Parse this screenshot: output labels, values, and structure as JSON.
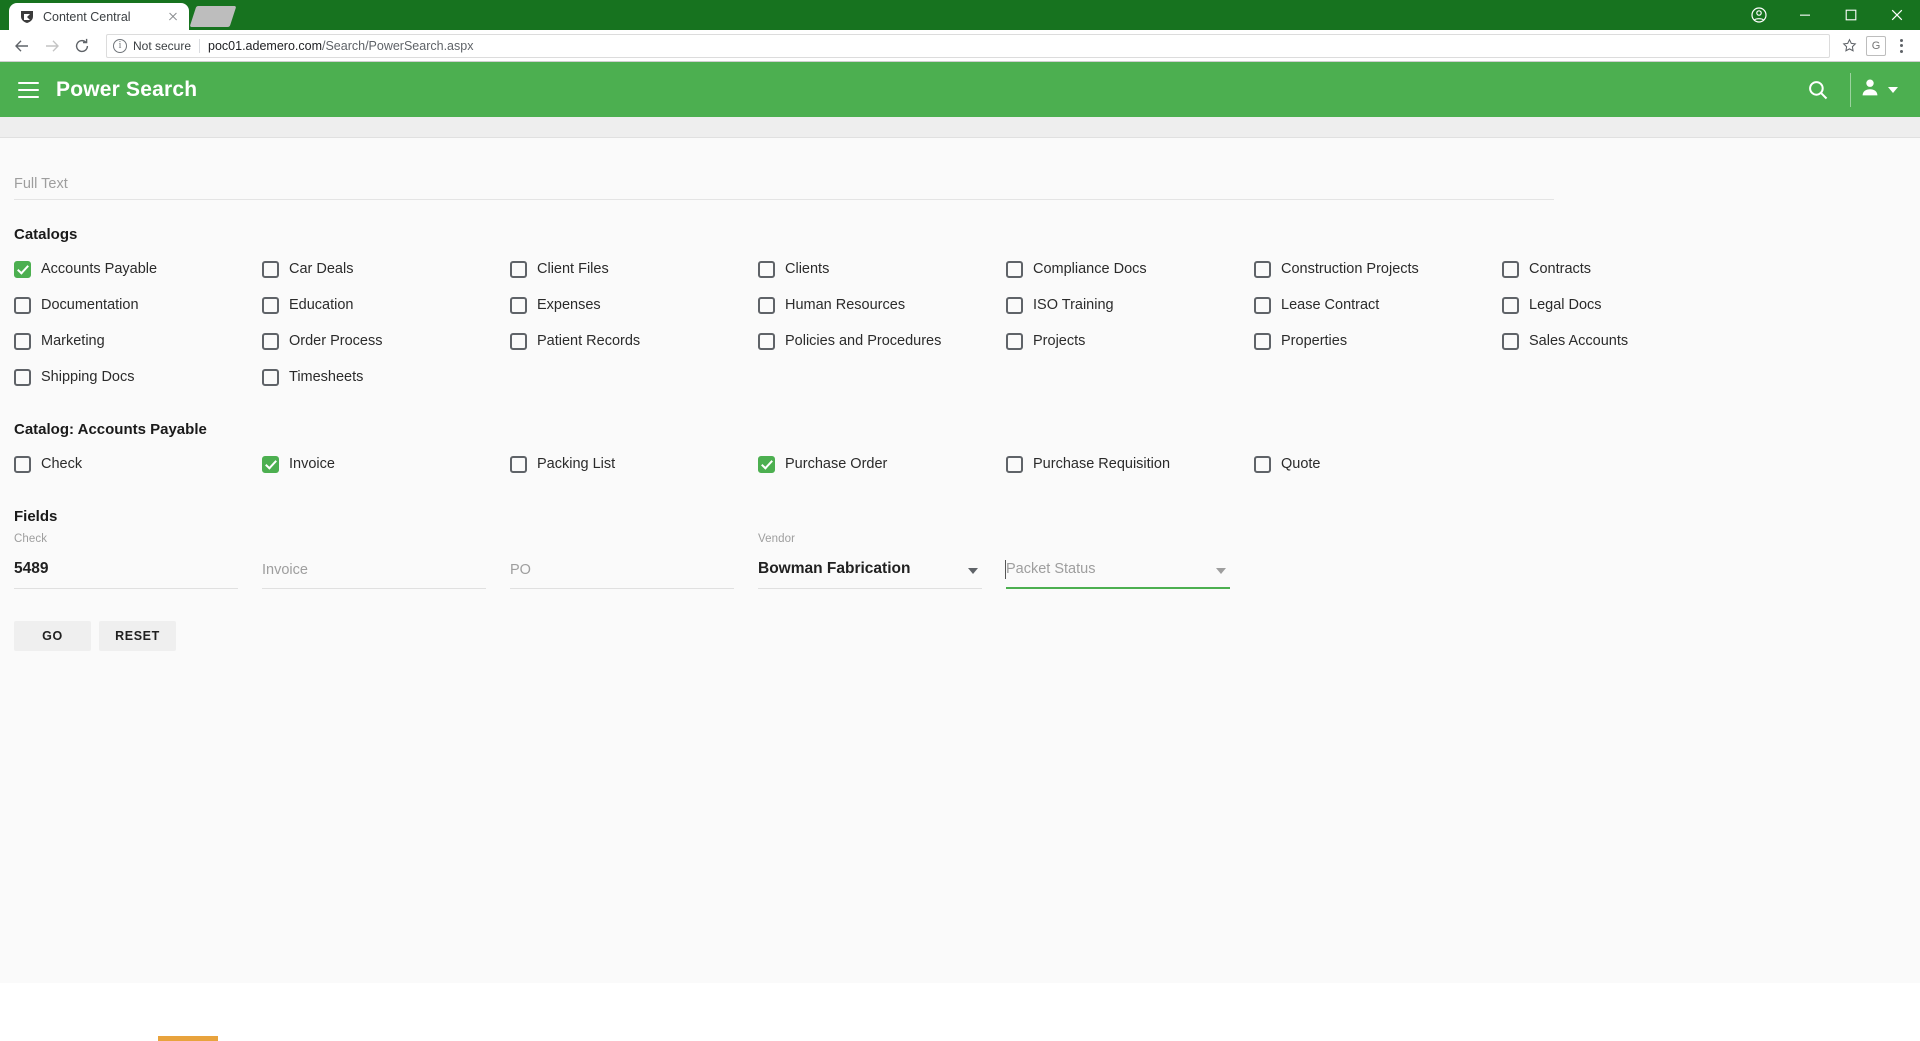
{
  "browser": {
    "tab": {
      "title": "Content Central",
      "favicon_icon": "shield-logo-icon",
      "close_icon": "close-icon"
    },
    "new_tab_icon": "new-tab-icon",
    "window_controls": {
      "account_icon": "account-icon",
      "minimize_icon": "minimize-icon",
      "maximize_icon": "maximize-icon",
      "close_icon": "window-close-icon"
    },
    "nav": {
      "back_icon": "back-arrow-icon",
      "forward_icon": "forward-arrow-icon",
      "reload_icon": "reload-icon"
    },
    "omnibox": {
      "info_icon": "info-circle-icon",
      "security_label": "Not secure",
      "url_host": "poc01.ademero.com",
      "url_path": "/Search/PowerSearch.aspx"
    },
    "toolbar_right": {
      "bookmark_icon": "star-icon",
      "profile_label": "G",
      "menu_icon": "kebab-menu-icon"
    }
  },
  "app": {
    "menu_icon": "hamburger-menu-icon",
    "title": "Power Search",
    "search_icon": "search-icon",
    "user_icon": "user-account-icon",
    "user_caret_icon": "chevron-down-icon",
    "accent_color": "#4caf50"
  },
  "search": {
    "fulltext_placeholder": "Full Text",
    "fulltext_value": ""
  },
  "catalogs": {
    "heading": "Catalogs",
    "items": [
      {
        "label": "Accounts Payable",
        "checked": true
      },
      {
        "label": "Car Deals",
        "checked": false
      },
      {
        "label": "Client Files",
        "checked": false
      },
      {
        "label": "Clients",
        "checked": false
      },
      {
        "label": "Compliance Docs",
        "checked": false
      },
      {
        "label": "Construction Projects",
        "checked": false
      },
      {
        "label": "Contracts",
        "checked": false
      },
      {
        "label": "Documentation",
        "checked": false
      },
      {
        "label": "Education",
        "checked": false
      },
      {
        "label": "Expenses",
        "checked": false
      },
      {
        "label": "Human Resources",
        "checked": false
      },
      {
        "label": "ISO Training",
        "checked": false
      },
      {
        "label": "Lease Contract",
        "checked": false
      },
      {
        "label": "Legal Docs",
        "checked": false
      },
      {
        "label": "Marketing",
        "checked": false
      },
      {
        "label": "Order Process",
        "checked": false
      },
      {
        "label": "Patient Records",
        "checked": false
      },
      {
        "label": "Policies and Procedures",
        "checked": false
      },
      {
        "label": "Projects",
        "checked": false
      },
      {
        "label": "Properties",
        "checked": false
      },
      {
        "label": "Sales Accounts",
        "checked": false
      },
      {
        "label": "Shipping Docs",
        "checked": false
      },
      {
        "label": "Timesheets",
        "checked": false
      }
    ]
  },
  "doc_types": {
    "heading": "Catalog: Accounts Payable",
    "items": [
      {
        "label": "Check",
        "checked": false
      },
      {
        "label": "Invoice",
        "checked": true
      },
      {
        "label": "Packing List",
        "checked": false
      },
      {
        "label": "Purchase Order",
        "checked": true
      },
      {
        "label": "Purchase Requisition",
        "checked": false
      },
      {
        "label": "Quote",
        "checked": false
      }
    ]
  },
  "fields": {
    "heading": "Fields",
    "items": [
      {
        "name": "check",
        "label": "Check",
        "value": "5489",
        "placeholder": "Check",
        "type": "text",
        "filled": true,
        "focused": false
      },
      {
        "name": "invoice",
        "label": "Invoice",
        "value": "",
        "placeholder": "Invoice",
        "type": "text",
        "filled": false,
        "focused": false
      },
      {
        "name": "po",
        "label": "PO",
        "value": "",
        "placeholder": "PO",
        "type": "text",
        "filled": false,
        "focused": false
      },
      {
        "name": "vendor",
        "label": "Vendor",
        "value": "Bowman Fabrication",
        "placeholder": "Vendor",
        "type": "select",
        "filled": true,
        "focused": false
      },
      {
        "name": "packet-status",
        "label": "Packet Status",
        "value": "",
        "placeholder": "Packet Status",
        "type": "select",
        "filled": false,
        "focused": true
      }
    ]
  },
  "actions": {
    "go_label": "GO",
    "reset_label": "RESET"
  }
}
